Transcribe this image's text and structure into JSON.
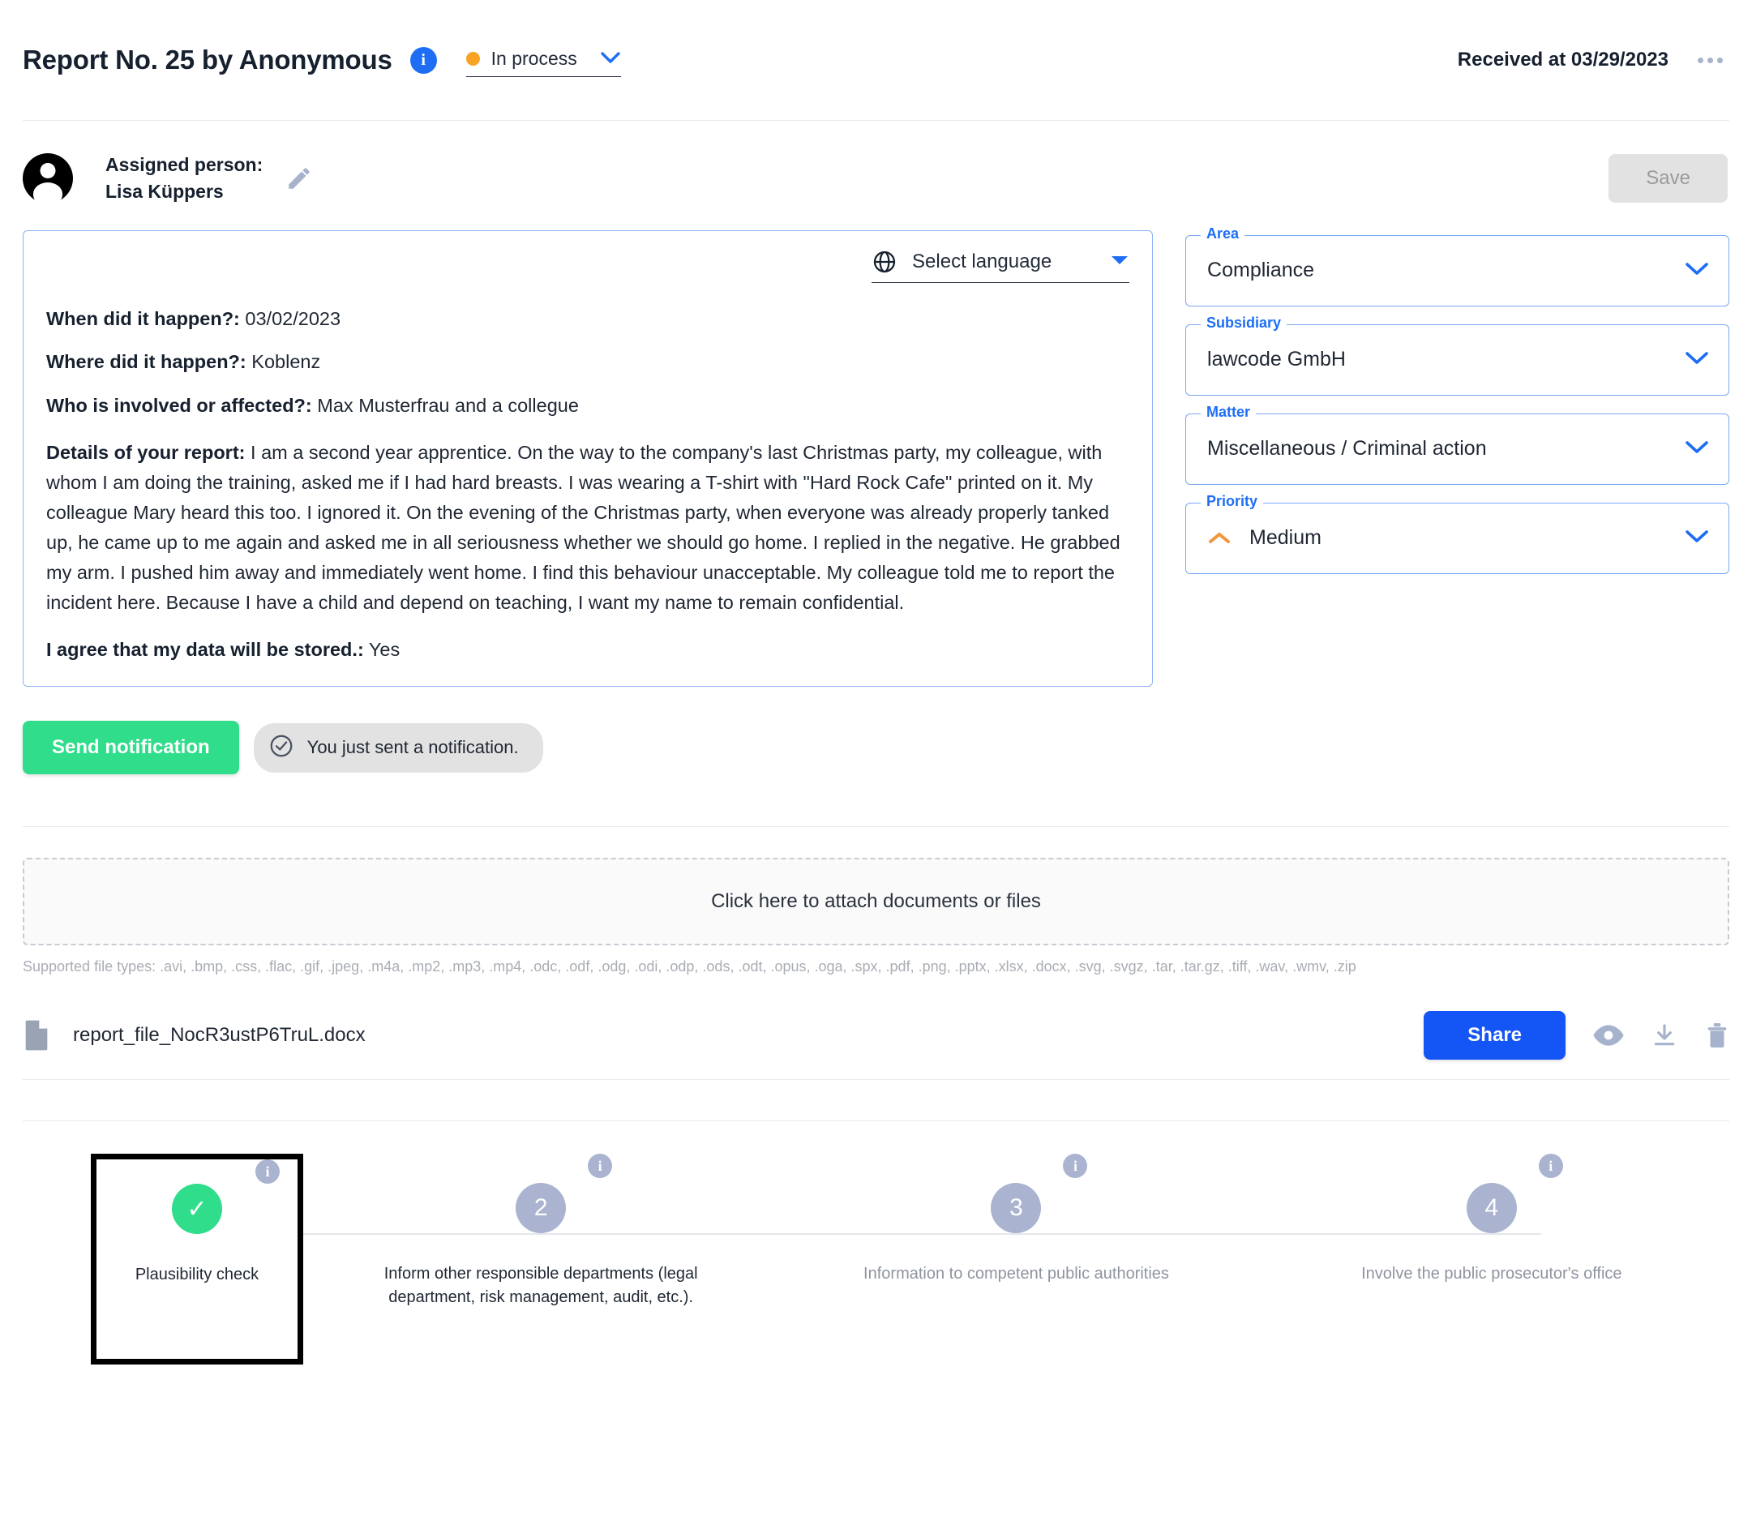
{
  "header": {
    "title": "Report No. 25 by Anonymous",
    "info_icon_label": "i",
    "status": "In process",
    "received": "Received at 03/29/2023"
  },
  "assigned": {
    "label": "Assigned person:",
    "name": "Lisa Küppers",
    "save_label": "Save"
  },
  "report": {
    "language_placeholder": "Select language",
    "q_when_label": "When did it happen?:",
    "q_when_value": " 03/02/2023",
    "q_where_label": "Where did it happen?:",
    "q_where_value": " Koblenz",
    "q_who_label": "Who is involved or affected?:",
    "q_who_value": " Max Musterfrau and a collegue",
    "details_label": "Details of your report:",
    "details_value": " I am a second year apprentice. On the way to the company's last Christmas party, my colleague, with whom I am doing the training, asked me if I had hard breasts. I was wearing a T-shirt with \"Hard Rock Cafe\" printed on it. My colleague Mary heard this too. I ignored it. On the evening of the Christmas party, when everyone was already properly tanked up, he came up to me again and asked me in all seriousness whether we should go home. I replied in the negative. He grabbed my arm. I pushed him away and immediately went home. I find this behaviour unacceptable. My colleague told me to report the incident here. Because I have a child and depend on teaching, I want my name to remain confidential.",
    "agree_label": "I agree that my data will be stored.:",
    "agree_value": " Yes"
  },
  "fields": {
    "area_label": "Area",
    "area_value": "Compliance",
    "subsidiary_label": "Subsidiary",
    "subsidiary_value": "lawcode GmbH",
    "matter_label": "Matter",
    "matter_value": "Miscellaneous / Criminal action",
    "priority_label": "Priority",
    "priority_value": "Medium"
  },
  "notification": {
    "send_label": "Send notification",
    "toast_text": "You just sent a notification."
  },
  "attachments": {
    "dropzone_label": "Click here to attach documents or files",
    "supported_text": "Supported file types: .avi, .bmp, .css, .flac, .gif, .jpeg, .m4a, .mp2, .mp3, .mp4, .odc, .odf, .odg, .odi, .odp, .ods, .odt, .opus, .oga, .spx, .pdf, .png, .pptx, .xlsx, .docx, .svg, .svgz, .tar, .tar.gz, .tiff, .wav, .wmv, .zip",
    "file_name": "report_file_NocR3ustP6TruL.docx",
    "share_label": "Share"
  },
  "stepper": {
    "steps": [
      {
        "marker": "✓",
        "label": "Plausibility check",
        "state": "done",
        "info": "i"
      },
      {
        "marker": "2",
        "label": "Inform other responsible departments (legal department, risk management, audit, etc.).",
        "state": "pending",
        "info": "i"
      },
      {
        "marker": "3",
        "label": "Information to competent public authorities",
        "state": "pending",
        "info": "i"
      },
      {
        "marker": "4",
        "label": "Involve the public prosecutor's office",
        "state": "pending",
        "info": "i"
      }
    ]
  },
  "colors": {
    "accent_blue": "#1456f5",
    "status_orange": "#f7a325",
    "success_green": "#2fdd8a",
    "step_gray": "#aab4d0"
  }
}
